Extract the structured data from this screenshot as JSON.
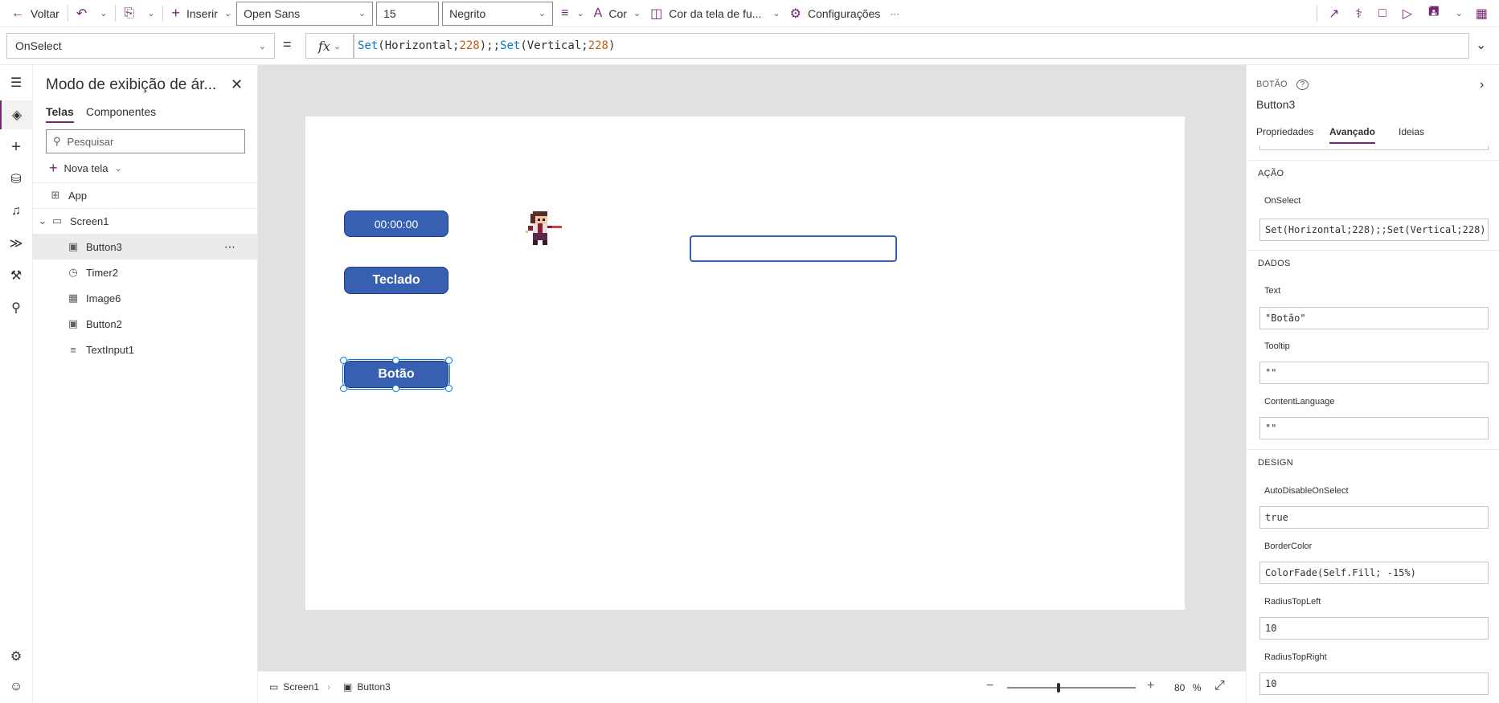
{
  "toolbar": {
    "back_label": "Voltar",
    "insert_label": "Inserir",
    "font_family": "Open Sans",
    "font_size": "15",
    "font_weight": "Negrito",
    "color_label": "Cor",
    "screen_color_label": "Cor da tela de fu...",
    "settings_label": "Configurações",
    "more_label": "···"
  },
  "formula_bar": {
    "property": "OnSelect",
    "equals": "=",
    "fx": "fx",
    "tokens": [
      {
        "t": "Set",
        "k": "fn"
      },
      {
        "t": "(Horizontal;",
        "k": "tx"
      },
      {
        "t": "228",
        "k": "num"
      },
      {
        "t": ");;",
        "k": "tx"
      },
      {
        "t": "Set",
        "k": "fn"
      },
      {
        "t": "(Vertical;",
        "k": "tx"
      },
      {
        "t": "228",
        "k": "num"
      },
      {
        "t": ")",
        "k": "tx"
      }
    ]
  },
  "tree": {
    "title": "Modo de exibição de ár...",
    "tabs": [
      "Telas",
      "Componentes"
    ],
    "search_placeholder": "Pesquisar",
    "new_screen_label": "Nova tela",
    "items": [
      {
        "label": "App",
        "icon": "app-icon"
      },
      {
        "label": "Screen1",
        "icon": "screen-icon"
      },
      {
        "label": "Button3",
        "icon": "button-icon"
      },
      {
        "label": "Timer2",
        "icon": "timer-icon"
      },
      {
        "label": "Image6",
        "icon": "image-icon"
      },
      {
        "label": "Button2",
        "icon": "button-icon"
      },
      {
        "label": "TextInput1",
        "icon": "text-input-icon"
      }
    ]
  },
  "canvas": {
    "timer_text": "00:00:00",
    "keyboard_text": "Teclado",
    "button_text": "Botão"
  },
  "statusbar": {
    "screen_crumb": "Screen1",
    "control_crumb": "Button3",
    "zoom_value": "80",
    "zoom_unit": "%",
    "zoom_level": 0.8
  },
  "props": {
    "control_type": "BOTÃO",
    "control_name": "Button3",
    "tabs": [
      "Propriedades",
      "Avançado",
      "Ideias"
    ],
    "sections": {
      "action": "AÇÃO",
      "data": "DADOS",
      "design": "DESIGN"
    },
    "fields": {
      "onselect": {
        "label": "OnSelect",
        "value": "Set(Horizontal;228);;Set(Vertical;228)"
      },
      "text": {
        "label": "Text",
        "value": "\"Botão\""
      },
      "tooltip": {
        "label": "Tooltip",
        "value": "\"\""
      },
      "contentlanguage": {
        "label": "ContentLanguage",
        "value": "\"\""
      },
      "autodisable": {
        "label": "AutoDisableOnSelect",
        "value": "true"
      },
      "bordercolor": {
        "label": "BorderColor",
        "value": "ColorFade(Self.Fill; -15%)"
      },
      "radiustopleft": {
        "label": "RadiusTopLeft",
        "value": "10"
      },
      "radiustopright": {
        "label": "RadiusTopRight",
        "value": "10"
      }
    }
  },
  "colors": {
    "accent": "#742774",
    "button_fill": "#3860b2",
    "selection": "#0078d4"
  }
}
